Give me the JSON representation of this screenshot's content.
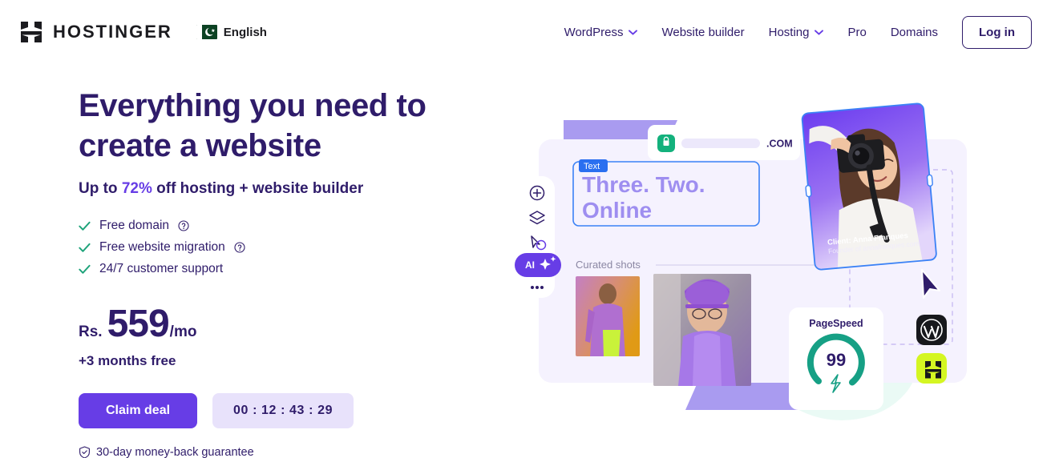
{
  "header": {
    "brand_name": "HOSTINGER",
    "logo_icon": "hostinger-h-logo",
    "language": {
      "label": "English",
      "flag": "pakistan-flag"
    },
    "nav": [
      {
        "label": "WordPress",
        "has_dropdown": true
      },
      {
        "label": "Website builder",
        "has_dropdown": false
      },
      {
        "label": "Hosting",
        "has_dropdown": true
      },
      {
        "label": "Pro",
        "has_dropdown": false
      },
      {
        "label": "Domains",
        "has_dropdown": false
      }
    ],
    "login_label": "Log in"
  },
  "hero": {
    "headline_line1": "Everything you need to",
    "headline_line2": "create a website",
    "subhead_prefix": "Up to ",
    "subhead_percent": "72%",
    "subhead_suffix": " off hosting + website builder",
    "features": [
      {
        "label": "Free domain",
        "info": true
      },
      {
        "label": "Free website migration",
        "info": true
      },
      {
        "label": "24/7 customer support",
        "info": false
      }
    ],
    "price": {
      "currency": "Rs.",
      "amount": "559",
      "period": "/mo"
    },
    "months_free": "+3 months free",
    "claim_label": "Claim deal",
    "timer": "00 : 12 : 43 : 29",
    "guarantee": "30-day money-back guarantee"
  },
  "illustration": {
    "domain_suffix": ".COM",
    "lock_icon": "green-lock-icon",
    "text_badge": "Text",
    "canvas_heading_line1": "Three. Two.",
    "canvas_heading_line2": "Online",
    "gallery_label": "Curated shots",
    "toolbar": [
      {
        "icon": "plus-circle-icon"
      },
      {
        "icon": "layers-icon"
      },
      {
        "icon": "cursor-comment-icon"
      },
      {
        "icon": "ai-sparkle-icon",
        "label": "AI"
      },
      {
        "icon": "more-dots-icon"
      }
    ],
    "photo_card": {
      "caption_line1": "Client: Anna Franques",
      "caption_line2": "Founder of annafranques.com"
    },
    "pagespeed": {
      "title": "PageSpeed",
      "score": "99",
      "bolt_icon": "lightning-bolt-icon"
    },
    "badges": [
      {
        "icon": "wordpress-logo",
        "bg": "#17181c"
      },
      {
        "icon": "hostinger-h-logo",
        "bg": "#d4f622"
      }
    ]
  },
  "colors": {
    "brand_purple": "#673de6",
    "deep_purple": "#2f1c6a",
    "timer_bg": "#e8e2fb",
    "green_check": "#1ea37a",
    "lime": "#d4f622",
    "teal": "#16a085"
  }
}
